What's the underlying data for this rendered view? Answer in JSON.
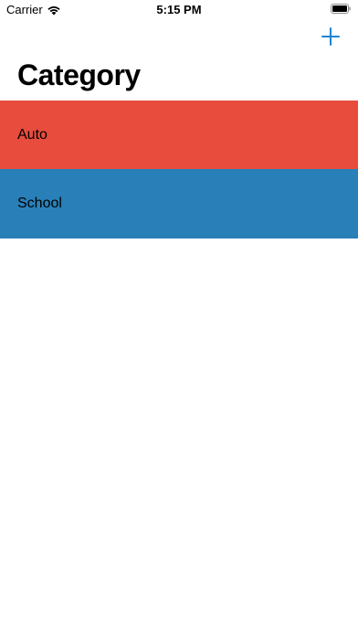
{
  "status_bar": {
    "carrier": "Carrier",
    "time": "5:15 PM",
    "wifi_icon": "wifi-icon",
    "battery_icon": "battery-icon"
  },
  "nav_bar": {
    "add_icon": "plus-icon",
    "accent_color": "#1a84d6"
  },
  "page": {
    "title": "Category"
  },
  "categories": [
    {
      "label": "Auto",
      "color": "#e74c3c"
    },
    {
      "label": "School",
      "color": "#2980b9"
    }
  ]
}
